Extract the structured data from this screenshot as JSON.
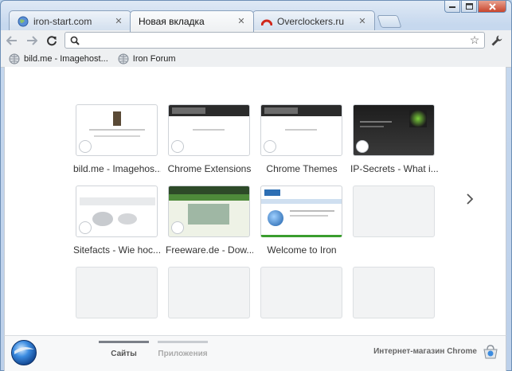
{
  "tabs": [
    {
      "title": "iron-start.com",
      "icon": "globe-icon",
      "active": false
    },
    {
      "title": "Новая вкладка",
      "icon": "",
      "active": true
    },
    {
      "title": "Overclockers.ru",
      "icon": "overclockers-icon",
      "active": false
    }
  ],
  "toolbar": {
    "omnibox_value": "",
    "back_icon": "back-arrow-icon",
    "forward_icon": "forward-arrow-icon",
    "reload_icon": "reload-icon"
  },
  "bookmarks": [
    {
      "label": "bild.me - Imagehost..."
    },
    {
      "label": "Iron Forum"
    }
  ],
  "tiles": [
    {
      "label": "bild.me - Imagehos...",
      "style": "bildme"
    },
    {
      "label": "Chrome Extensions",
      "style": "chrome"
    },
    {
      "label": "Chrome Themes",
      "style": "chrome"
    },
    {
      "label": "IP-Secrets - What i...",
      "style": "ipsecrets"
    },
    {
      "label": "Sitefacts - Wie hoc...",
      "style": "sitefacts"
    },
    {
      "label": "Freeware.de - Dow...",
      "style": "freeware"
    },
    {
      "label": "Welcome to Iron",
      "style": "iron"
    },
    {
      "label": "",
      "style": "empty"
    },
    {
      "label": "",
      "style": "empty"
    },
    {
      "label": "",
      "style": "empty"
    },
    {
      "label": "",
      "style": "empty"
    },
    {
      "label": "",
      "style": "empty"
    }
  ],
  "footer": {
    "tab_sites": "Сайты",
    "tab_apps": "Приложения",
    "store_label": "Интернет-магазин Chrome"
  },
  "colors": {
    "frame": "#c6d8ee",
    "close_button": "#c9452c",
    "active_footer_tab": "#7b8088"
  }
}
